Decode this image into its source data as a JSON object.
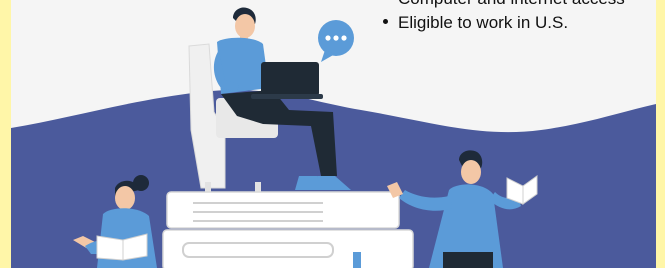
{
  "requirements": {
    "items": [
      {
        "text": "Computer and internet access",
        "visible_fraction": 0.35
      },
      {
        "text": "Eligible to work in U.S."
      }
    ]
  },
  "illustration": {
    "speech_bubble_text": "•••",
    "colors": {
      "wave": "#4b5a9c",
      "shirt": "#5b9bd8",
      "hair": "#1e2a3a",
      "skin": "#f3c7a6",
      "trousers": "#1f2a35",
      "book": "#ffffff",
      "chair": "#f0f0f0"
    }
  }
}
